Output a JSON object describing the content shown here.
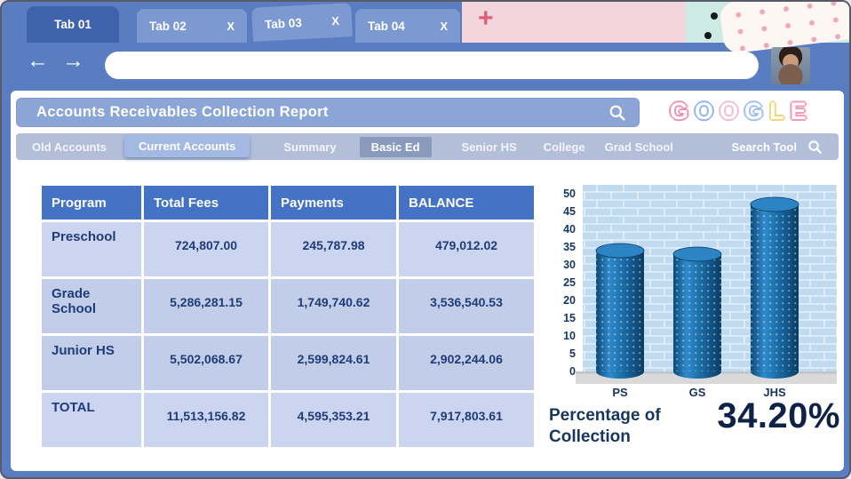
{
  "window": {
    "tabs": [
      {
        "label": "Tab 01",
        "active": true
      },
      {
        "label": "Tab 02",
        "close": "X",
        "active": false
      },
      {
        "label": "Tab 03",
        "close": "X",
        "active": false
      },
      {
        "label": "Tab 04",
        "close": "X",
        "active": false
      }
    ],
    "new_tab_label": "+"
  },
  "nav": {
    "back_icon": "←",
    "forward_icon": "→",
    "address_value": ""
  },
  "report": {
    "title": "Accounts Receivables Collection Report",
    "logo": {
      "text": "GOOGLE",
      "letters": [
        "G",
        "O",
        "O",
        "G",
        "L",
        "E"
      ],
      "colors": [
        "#f08fae",
        "#8fb3ea",
        "#f3bccd",
        "#9cc0ee",
        "#ecd97e",
        "#f49ab5"
      ]
    },
    "filters": [
      {
        "label": "Old Accounts",
        "selected": false
      },
      {
        "label": "Current Accounts",
        "selected": true
      },
      {
        "label": "Summary",
        "selected": false
      },
      {
        "label": "Basic Ed",
        "selected": true
      },
      {
        "label": "Senior HS",
        "selected": false
      },
      {
        "label": "College",
        "selected": false
      },
      {
        "label": "Grad School",
        "selected": false
      },
      {
        "label": "Search Tool",
        "selected": false
      }
    ],
    "table": {
      "headers": [
        "Program",
        "Total Fees",
        "Payments",
        "BALANCE"
      ],
      "rows": [
        {
          "program": "Preschool",
          "total_fees": "724,807.00",
          "payments": "245,787.98",
          "balance": "479,012.02"
        },
        {
          "program": "Grade School",
          "total_fees": "5,286,281.15",
          "payments": "1,749,740.62",
          "balance": "3,536,540.53"
        },
        {
          "program": "Junior HS",
          "total_fees": "5,502,068.67",
          "payments": "2,599,824.61",
          "balance": "2,902,244.06"
        },
        {
          "program": "TOTAL",
          "total_fees": "11,513,156.82",
          "payments": "4,595,353.21",
          "balance": "7,917,803.61"
        }
      ]
    },
    "summary": {
      "label": "Percentage of Collection",
      "value": "34.20%"
    }
  },
  "chart_data": {
    "type": "bar",
    "style": "3d-cylinder",
    "categories": [
      "PS",
      "GS",
      "JHS"
    ],
    "values": [
      34,
      33,
      47
    ],
    "ylim": [
      0,
      50
    ],
    "yticks": [
      0,
      5,
      10,
      15,
      20,
      25,
      30,
      35,
      40,
      45,
      50
    ],
    "grid": false,
    "legend": false,
    "title": "",
    "xlabel": "",
    "ylabel": "",
    "bar_color": "#1a6aa9",
    "wall_color": "#c0daf0",
    "floor_color": "#d9d9d9"
  },
  "colors": {
    "frame": "#5a7cc1",
    "active_tab": "#3e62ac",
    "inactive_tab": "#7d99d2",
    "table_header": "#4472c4",
    "row_light": "#ccd5ef",
    "row_dark": "#c2cde9",
    "text_dark": "#1f3c78"
  }
}
